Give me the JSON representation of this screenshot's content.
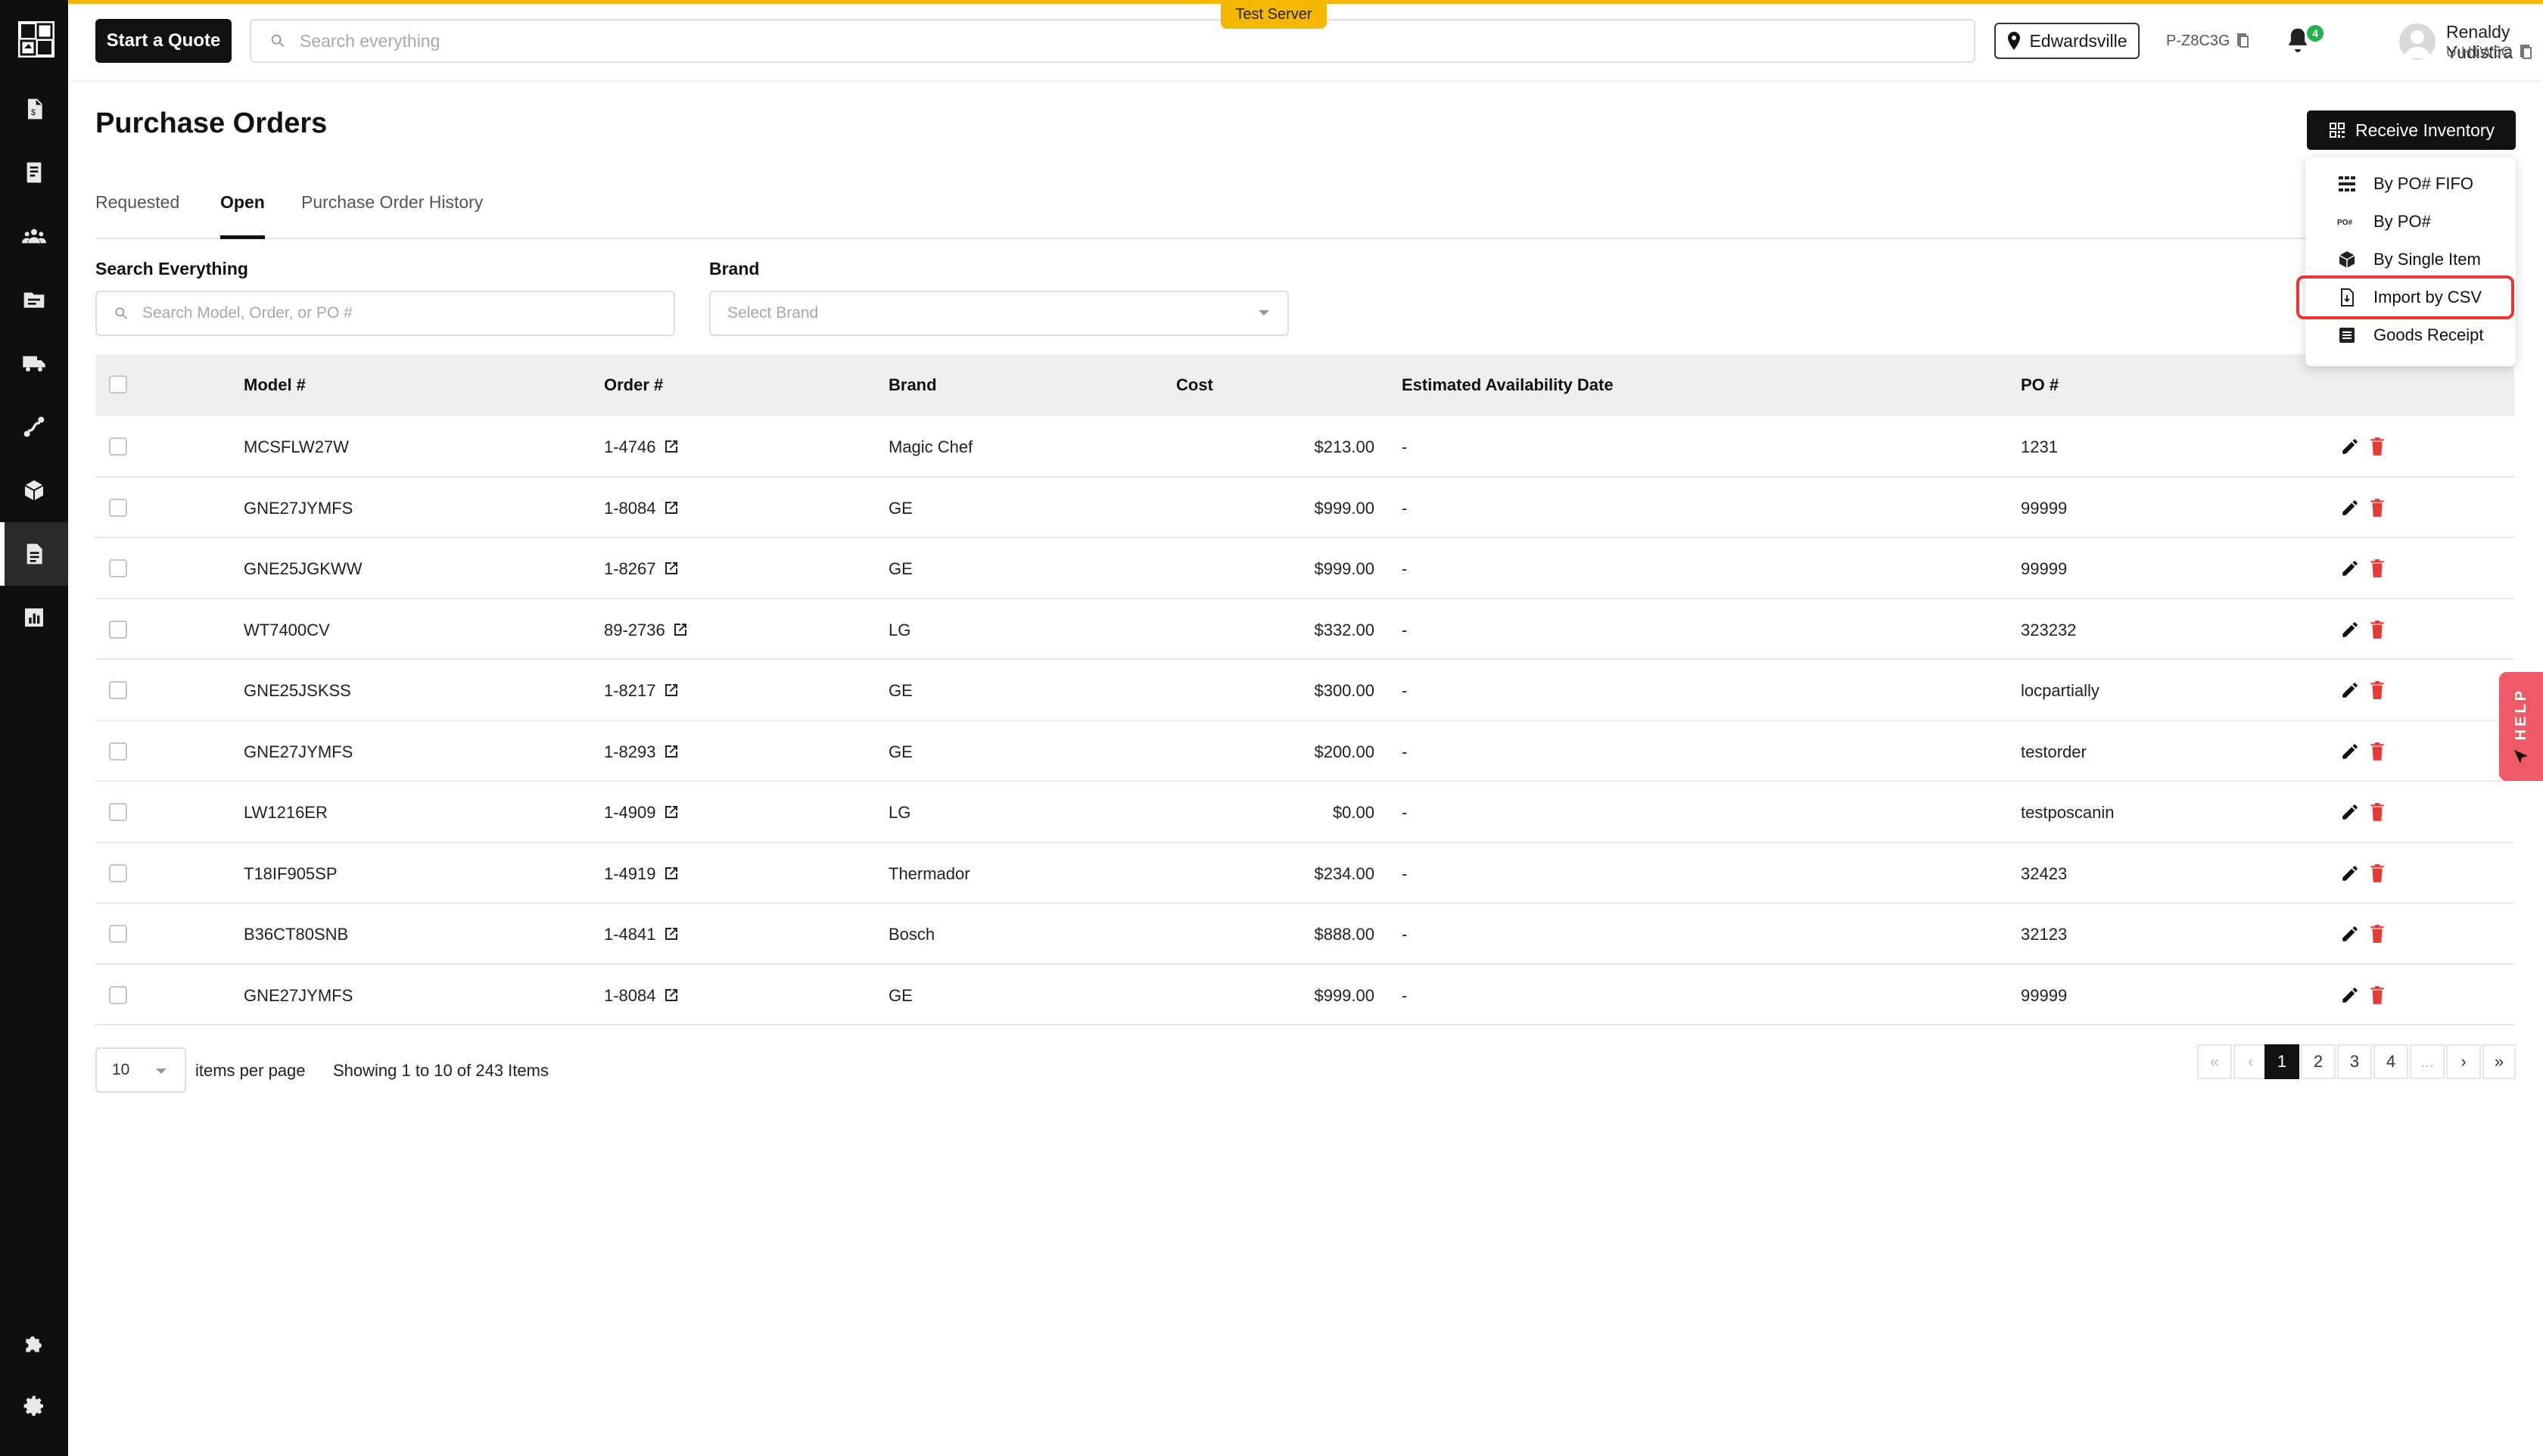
{
  "app": {
    "test_badge": "Test Server",
    "quote_button": "Start a Quote",
    "search_placeholder": "Search everything",
    "location": "Edwardsville",
    "project_code": "P-Z8C3G",
    "notification_count": "4",
    "user_name": "Renaldy Yudistira",
    "user_code": "U-H1W5O",
    "accent_color": "#f5b800"
  },
  "sidebar": {
    "items": [
      {
        "icon": "invoice-icon"
      },
      {
        "icon": "receipt-icon"
      },
      {
        "icon": "users-icon"
      },
      {
        "icon": "folder-icon"
      },
      {
        "icon": "truck-icon"
      },
      {
        "icon": "route-icon"
      },
      {
        "icon": "box-icon"
      },
      {
        "icon": "document-icon",
        "active": true
      },
      {
        "icon": "chart-icon"
      },
      {
        "icon": "puzzle-icon"
      },
      {
        "icon": "gear-icon"
      }
    ]
  },
  "page": {
    "title": "Purchase Orders",
    "receive_button": "Receive Inventory",
    "tabs": [
      "Requested",
      "Open",
      "Purchase Order History"
    ],
    "active_tab": "Open"
  },
  "filters": {
    "search_label": "Search Everything",
    "search_placeholder": "Search Model, Order, or PO #",
    "brand_label": "Brand",
    "brand_placeholder": "Select Brand"
  },
  "table": {
    "columns": [
      "Model #",
      "Order #",
      "Brand",
      "Cost",
      "Estimated Availability Date",
      "PO #"
    ],
    "rows": [
      {
        "model": "MCSFLW27W",
        "order": "1-4746",
        "brand": "Magic Chef",
        "cost": "$213.00",
        "eta": "-",
        "po": "1231"
      },
      {
        "model": "GNE27JYMFS",
        "order": "1-8084",
        "brand": "GE",
        "cost": "$999.00",
        "eta": "-",
        "po": "99999"
      },
      {
        "model": "GNE25JGKWW",
        "order": "1-8267",
        "brand": "GE",
        "cost": "$999.00",
        "eta": "-",
        "po": "99999"
      },
      {
        "model": "WT7400CV",
        "order": "89-2736",
        "brand": "LG",
        "cost": "$332.00",
        "eta": "-",
        "po": "323232"
      },
      {
        "model": "GNE25JSKSS",
        "order": "1-8217",
        "brand": "GE",
        "cost": "$300.00",
        "eta": "-",
        "po": "locpartially"
      },
      {
        "model": "GNE27JYMFS",
        "order": "1-8293",
        "brand": "GE",
        "cost": "$200.00",
        "eta": "-",
        "po": "testorder"
      },
      {
        "model": "LW1216ER",
        "order": "1-4909",
        "brand": "LG",
        "cost": "$0.00",
        "eta": "-",
        "po": "testposcanin"
      },
      {
        "model": "T18IF905SP",
        "order": "1-4919",
        "brand": "Thermador",
        "cost": "$234.00",
        "eta": "-",
        "po": "32423"
      },
      {
        "model": "B36CT80SNB",
        "order": "1-4841",
        "brand": "Bosch",
        "cost": "$888.00",
        "eta": "-",
        "po": "32123"
      },
      {
        "model": "GNE27JYMFS",
        "order": "1-8084",
        "brand": "GE",
        "cost": "$999.00",
        "eta": "-",
        "po": "99999"
      }
    ]
  },
  "pagination": {
    "page_size": "10",
    "items_per_page_label": "items per page",
    "showing": "Showing 1 to 10 of 243 Items",
    "first": "«",
    "prev": "‹",
    "pages": [
      "1",
      "2",
      "3",
      "4"
    ],
    "ellipsis": "...",
    "next": "›",
    "last": "»",
    "current": "1"
  },
  "receive_menu": {
    "items": [
      {
        "label": "By PO# FIFO",
        "icon": "fifo-icon"
      },
      {
        "label": "By PO#",
        "icon": "po-icon",
        "icon_text": "PO#"
      },
      {
        "label": "By Single Item",
        "icon": "cube-icon"
      },
      {
        "label": "Import by CSV",
        "icon": "csv-file-icon",
        "highlighted": true
      },
      {
        "label": "Goods Receipt",
        "icon": "receipt-list-icon"
      }
    ]
  },
  "help": {
    "label": "HELP"
  }
}
